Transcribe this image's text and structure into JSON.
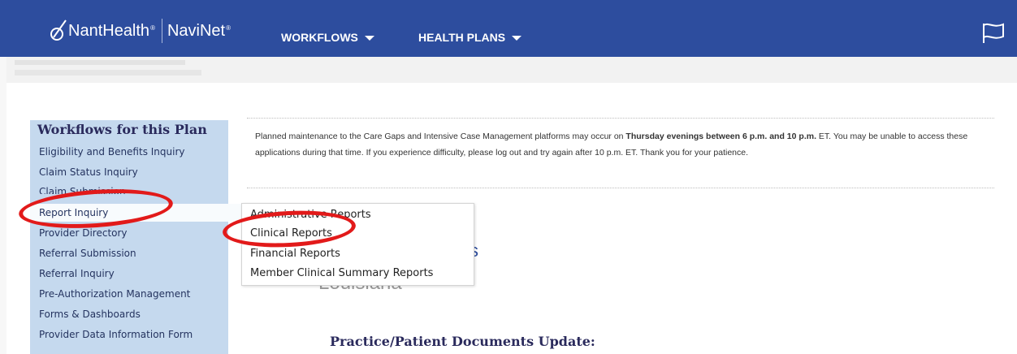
{
  "header": {
    "brand_nant": "NantHealth",
    "brand_navinet": "NaviNet",
    "nav": [
      {
        "label": "WORKFLOWS"
      },
      {
        "label": "HEALTH PLANS"
      }
    ],
    "flag_icon": "flag-icon",
    "colors": {
      "bar": "#2d4d9e"
    }
  },
  "sidebar": {
    "title": "Workflows for this Plan",
    "items": [
      {
        "label": "Eligibility and Benefits Inquiry"
      },
      {
        "label": "Claim Status Inquiry"
      },
      {
        "label": "Claim Submission"
      },
      {
        "label": "Report Inquiry"
      },
      {
        "label": "Provider Directory"
      },
      {
        "label": "Referral Submission"
      },
      {
        "label": "Referral Inquiry"
      },
      {
        "label": "Pre-Authorization Management"
      },
      {
        "label": "Forms & Dashboards"
      },
      {
        "label": "Provider Data Information Form"
      }
    ]
  },
  "notice": {
    "text_before": "Planned maintenance to the Care Gaps and Intensive Case Management platforms may occur on ",
    "text_bold": "Thursday evenings between 6 p.m. and 10 p.m.",
    "text_after": " ET. You may be unable to access these applications during that time. If you experience difficulty, please log out and try again after 10 p.m. ET. Thank you for your patience."
  },
  "submenu": {
    "items": [
      {
        "label": "Administrative Reports"
      },
      {
        "label": "Clinical Reports"
      },
      {
        "label": "Financial Reports"
      },
      {
        "label": "Member Clinical Summary Reports"
      }
    ]
  },
  "content": {
    "partial_text": "Louisiana",
    "heading": "Practice/Patient Documents Update:"
  },
  "annotation_color": "#e21a1a"
}
